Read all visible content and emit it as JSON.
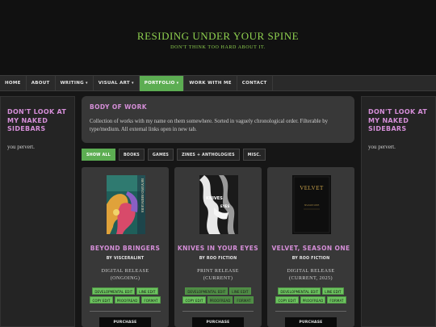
{
  "site": {
    "title": "RESIDING UNDER YOUR SPINE",
    "tagline": "DON'T THINK TOO HARD ABOUT IT."
  },
  "nav": {
    "home": "HOME",
    "about": "ABOUT",
    "writing": "WRITING",
    "visual_art": "VISUAL ART",
    "portfolio": "PORTFOLIO",
    "work_with_me": "WORK WITH ME",
    "contact": "CONTACT",
    "caret": "▾"
  },
  "sidebar": {
    "title": "DON'T LOOK AT MY NAKED SIDEBARS",
    "text": "you pervert."
  },
  "main": {
    "title": "BODY OF WORK",
    "description": "Collection of works with my name on them somewhere. Sorted in vaguely chronological order. Filterable by type/medium. All external links open in new tab."
  },
  "filters": [
    "SHOW ALL",
    "BOOKS",
    "GAMES",
    "ZINES + ANTHOLOGIES",
    "MISC."
  ],
  "cards": [
    {
      "title": "BEYOND BRINGERS",
      "by": "BY VISCERALINT",
      "release_1": "DIGITAL RELEASE",
      "release_2": "(ONGOING)",
      "cover_text": "BEYOND BRINGERS",
      "tags": [
        "DEVELOPMENTAL EDIT",
        "LINE EDIT",
        "COPY EDIT",
        "PROOFREAD",
        "FORMAT"
      ],
      "button": "PURCHASE"
    },
    {
      "title": "KNIVES IN YOUR EYES",
      "by": "BY ROO FICTION",
      "release_1": "PRINT RELEASE",
      "release_2": "(CURRENT)",
      "cover_text_1": "KNIVES",
      "cover_text_2": "EYES",
      "tags": [
        "DEVELOPMENTAL EDIT",
        "LINE EDIT",
        "COPY EDIT",
        "PROOFREAD",
        "FORMAT"
      ],
      "button": "PURCHASE"
    },
    {
      "title": "VELVET, SEASON ONE",
      "by": "BY ROO FICTION",
      "release_1": "DIGITAL RELEASE",
      "release_2": "(CURRENT, 2025)",
      "cover_text_1": "VELVET",
      "cover_text_2": "SEASON ONE",
      "tags": [
        "DEVELOPMENTAL EDIT",
        "LINE EDIT",
        "COPY EDIT",
        "PROOFREAD",
        "FORMAT"
      ],
      "button": "PURCHASE"
    }
  ],
  "colors": {
    "accent_green": "#5cad52",
    "title_green": "#8fd14f",
    "heading_pink": "#d58ed8",
    "background": "#161616",
    "panel": "#383838"
  }
}
